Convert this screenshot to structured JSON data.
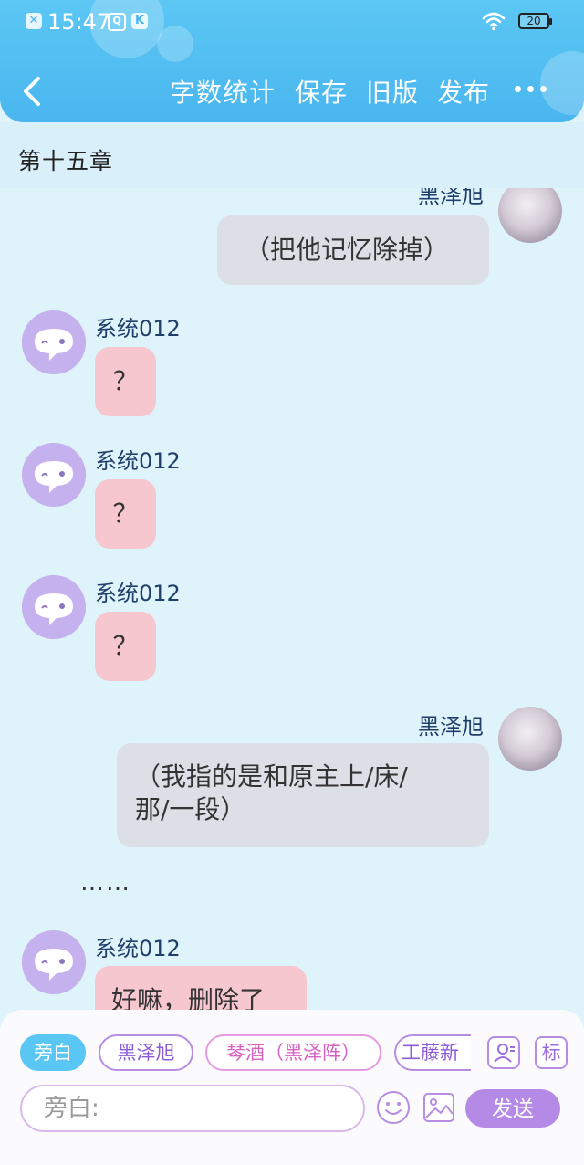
{
  "status_bar": {
    "time": "15:47",
    "battery": "20",
    "notif_icons": [
      "x-badge-icon",
      "q-badge-icon",
      "k-badge-icon"
    ]
  },
  "header": {
    "actions": [
      {
        "label": "字数统计"
      },
      {
        "label": "保存"
      },
      {
        "label": "旧版"
      },
      {
        "label": "发布"
      }
    ]
  },
  "chapter": {
    "title": "第十五章"
  },
  "chat": {
    "messages": [
      {
        "speaker": "黑泽旭",
        "side": "right",
        "text_lines": [
          "（把他记忆除掉）"
        ]
      },
      {
        "speaker": "系统012",
        "side": "left",
        "text_lines": [
          "？"
        ]
      },
      {
        "speaker": "系统012",
        "side": "left",
        "text_lines": [
          "？"
        ]
      },
      {
        "speaker": "系统012",
        "side": "left",
        "text_lines": [
          "？"
        ]
      },
      {
        "speaker": "黑泽旭",
        "side": "right",
        "text_lines": [
          "（我指的是和原主上/床/",
          "那/一段）"
        ]
      },
      {
        "speaker": "系统012",
        "side": "left",
        "text_lines": [
          "好嘛，删除了"
        ]
      }
    ],
    "narration": "……"
  },
  "input_panel": {
    "roles": [
      {
        "label": "旁白",
        "active": true
      },
      {
        "label": "黑泽旭",
        "active": false
      },
      {
        "label": "琴酒（黑泽阵）",
        "active": false
      },
      {
        "label": "工藤新",
        "active": false
      }
    ],
    "tools": {
      "tag_label": "标"
    },
    "input": {
      "placeholder": "旁白:",
      "value": ""
    },
    "send_label": "发送"
  },
  "colors": {
    "header": "#4fbdf1",
    "background": "#dff3fb",
    "bubble_gray": "#dcdfe5",
    "bubble_pink": "#f7c7d0",
    "bot_avatar": "#c6b1ef",
    "accent_purple": "#b48ae6",
    "active_chip": "#59c6f3"
  }
}
